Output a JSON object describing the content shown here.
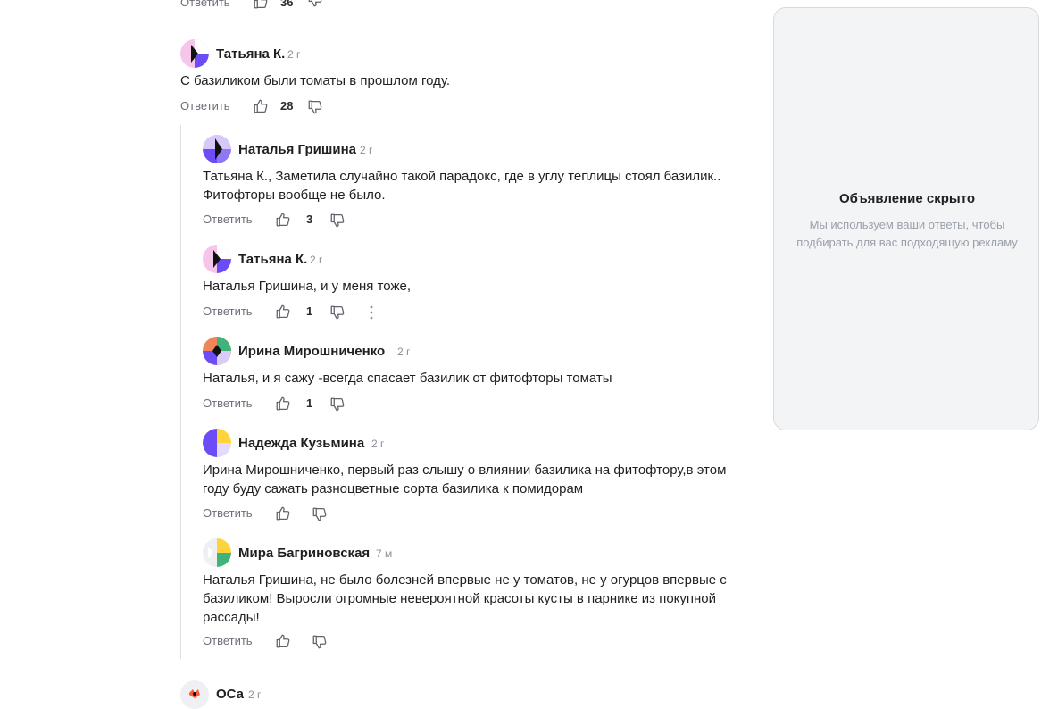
{
  "top_comment_partial": {
    "reply_label": "Ответить",
    "likes": "36"
  },
  "comments": [
    {
      "author": "Татьяна К.",
      "time": "2 г",
      "text": "С базиликом были томаты в прошлом году.",
      "reply_label": "Ответить",
      "likes": "28"
    }
  ],
  "replies": [
    {
      "author": "Наталья Гришина",
      "time": "2 г",
      "text": "Татьяна К., Заметила случайно такой парадокс, где в углу теплицы стоял базилик.. Фитофторы вообще не было.",
      "reply_label": "Ответить",
      "likes": "3"
    },
    {
      "author": "Татьяна К.",
      "time": "2 г",
      "text": "Наталья Гришина, и у меня тоже,",
      "reply_label": "Ответить",
      "likes": "1"
    },
    {
      "author": "Ирина Мирошниченко",
      "time": "2 г",
      "text": "Наталья, и я сажу -всегда спасает базилик от фитофторы томаты",
      "reply_label": "Ответить",
      "likes": "1"
    },
    {
      "author": "Надежда Кузьмина",
      "time": "2 г",
      "text": "Ирина Мирошниченко, первый раз слышу о влиянии базилика на фитофтору,в этом году буду сажать разноцветные сорта базилика к помидорам",
      "reply_label": "Ответить",
      "likes": ""
    },
    {
      "author": "Мира Багриновская",
      "time": "7 м",
      "text": "Наталья Гришина, не было болезней впервые не у томатов, не у огурцов впервые с базиликом! Выросли огромные невероятной красоты кусты в парнике из покупной рассады!",
      "reply_label": "Ответить",
      "likes": ""
    }
  ],
  "bottom_comment_partial": {
    "author": "ОСа",
    "time": "2 г"
  },
  "ad": {
    "title": "Объявление скрыто",
    "subtitle": "Мы используем ваши ответы, чтобы подбирать для вас подходящую рекламу"
  },
  "icons": {
    "like": "thumb-up-icon",
    "dislike": "thumb-down-icon",
    "more": "more-vertical-icon"
  },
  "colors": {
    "accent_purple": "#6b4cf6",
    "muted_text": "#8a8f99",
    "ad_background": "#f3f4f6"
  }
}
